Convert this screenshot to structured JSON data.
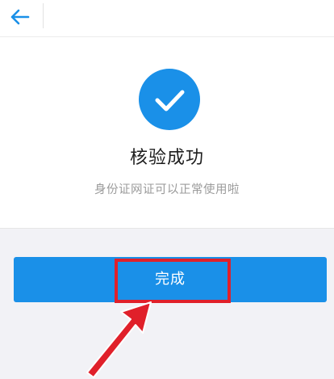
{
  "header": {
    "back_icon": "arrow-left-icon"
  },
  "result": {
    "icon": "check-circle-icon",
    "title": "核验成功",
    "subtitle": "身份证网证可以正常使用啦"
  },
  "actions": {
    "done_label": "完成"
  },
  "colors": {
    "accent": "#1a90e8",
    "highlight": "#e0202a",
    "page_background": "#f2f2f6"
  },
  "annotation": {
    "icon": "pointer-arrow-icon"
  }
}
